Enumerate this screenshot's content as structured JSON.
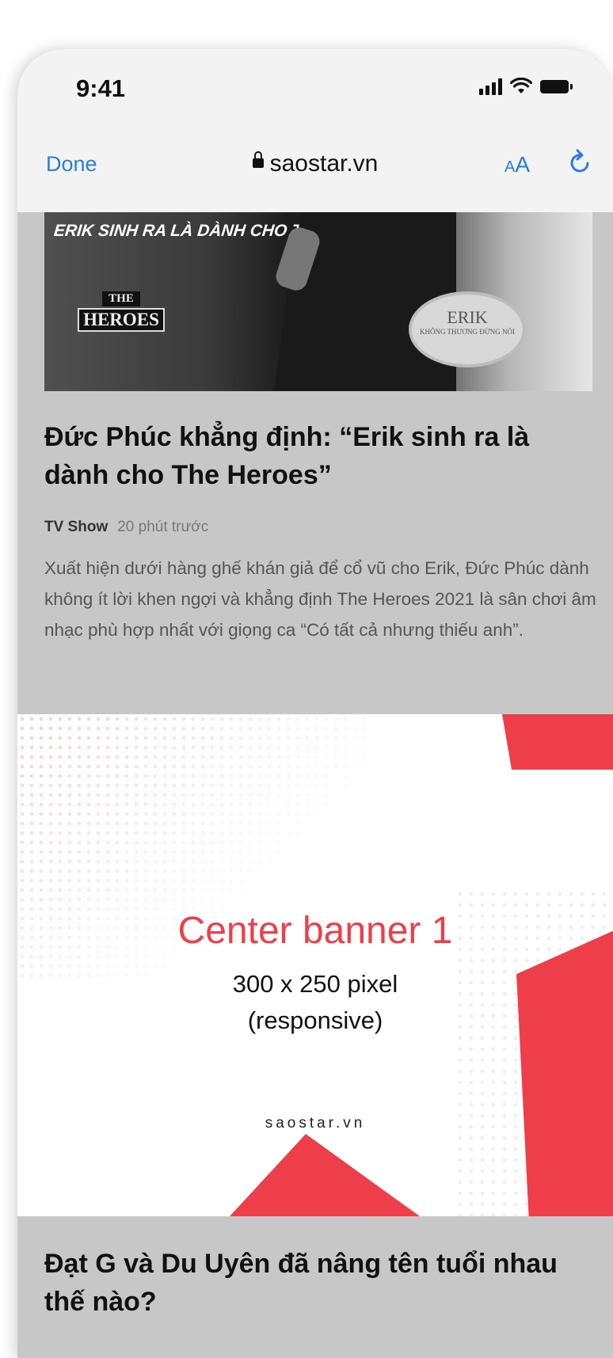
{
  "status_bar": {
    "time": "9:41"
  },
  "browser": {
    "done_label": "Done",
    "url": "saostar.vn",
    "text_size_small": "A",
    "text_size_big": "A"
  },
  "article1": {
    "image_overlay_text": "ERIK SINH RA LÀ DÀNH CHO THE HEROES",
    "image_logo_top": "THE",
    "image_logo_bottom": "HEROES",
    "image_sign_title": "ERIK",
    "image_sign_subtitle": "KHÔNG THƯƠNG ĐỪNG NÓI",
    "title": "Đức Phúc khẳng định: “Erik sinh ra là dành cho The Heroes”",
    "category": "TV Show",
    "time": "20 phút trước",
    "excerpt": "Xuất hiện dưới hàng ghế khán giả để cổ vũ cho Erik, Đức Phúc dành không ít lời khen ngợi và khẳng định The Heroes 2021 là sân chơi âm nhạc phù hợp nhất với giọng ca “Có tất cả nhưng thiếu anh”."
  },
  "banner": {
    "title": "Center banner 1",
    "size": "300 x 250 pixel",
    "note": "(responsive)",
    "site": "saostar.vn",
    "accent_color": "#ee3e4a"
  },
  "article2": {
    "title": "Đạt G và Du Uyên đã nâng tên tuổi nhau thế nào?"
  }
}
